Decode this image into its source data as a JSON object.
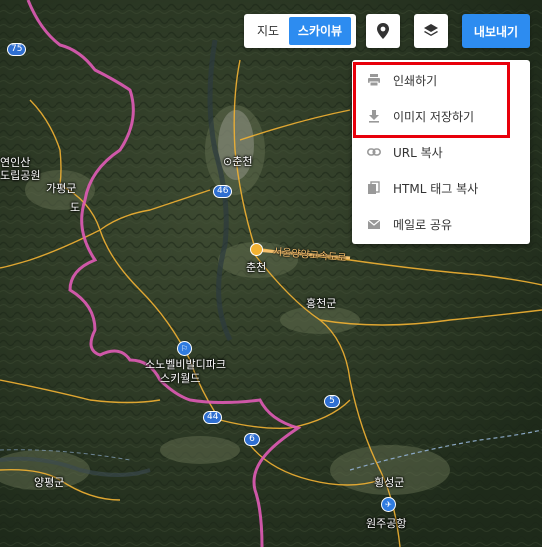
{
  "map_controls": {
    "map_label": "지도",
    "skyview_label": "스카이뷰",
    "export_label": "내보내기"
  },
  "export_menu": {
    "items": [
      {
        "label": "인쇄하기",
        "icon": "printer-icon"
      },
      {
        "label": "이미지 저장하기",
        "icon": "download-icon"
      },
      {
        "label": "URL 복사",
        "icon": "link-icon"
      },
      {
        "label": "HTML 태그 복사",
        "icon": "copy-icon"
      },
      {
        "label": "메일로 공유",
        "icon": "mail-icon"
      }
    ],
    "highlight_color": "#e8000b"
  },
  "map_labels": {
    "chuncheon_station": "춘천",
    "chuncheon_city": "춘천",
    "hongcheon": "홍천군",
    "gapyeong": "가평군",
    "gapyeong_extra": "도",
    "yeonin_park": "연인산\n도립공원",
    "vivaldi_park_line1": "소노벨비발디파크",
    "vivaldi_park_line2": "스키월드",
    "yangpyeong": "양평군",
    "hoengseong": "횡성군",
    "wonju_airport": "원주공항",
    "expressway": "서울양양고속도로"
  },
  "route_shields": [
    "75",
    "46",
    "5",
    "44",
    "6"
  ],
  "colors": {
    "accent_blue": "#2d8cf0",
    "boundary_pink": "#e05bb6",
    "road_yellow": "#f2b233"
  }
}
